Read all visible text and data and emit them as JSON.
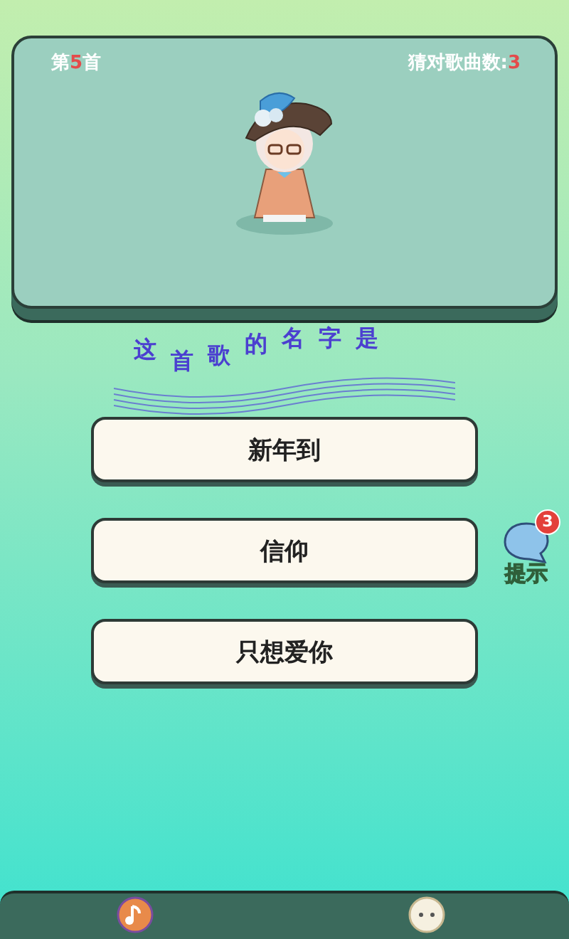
{
  "header": {
    "round": {
      "prefix": "第",
      "number": "5",
      "suffix": "首"
    },
    "score": {
      "label": "猜对歌曲数:",
      "value": "3"
    }
  },
  "question": "这首歌的名字是",
  "options": [
    {
      "label": "新年到"
    },
    {
      "label": "信仰"
    },
    {
      "label": "只想爱你"
    }
  ],
  "hint": {
    "label": "提示",
    "count": "3"
  }
}
